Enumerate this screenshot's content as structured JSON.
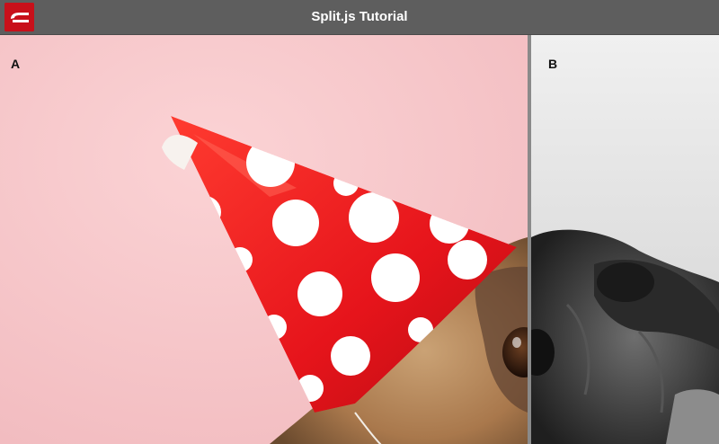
{
  "window": {
    "title": "Split.js Tutorial",
    "logo_icon": "split-js-logo-icon",
    "titlebar_color": "#5e5e5e"
  },
  "split": {
    "left_pane": {
      "label": "A",
      "background": "#f6c6c9",
      "image": "pug-with-red-polka-dot-party-hat-color-photo"
    },
    "right_pane": {
      "label": "B",
      "background": "#e3e3e3",
      "image": "pug-with-party-hat-grayscale-photo"
    },
    "gutter_icon": "column-resize-gutter",
    "accent_color": "#c8101a"
  }
}
